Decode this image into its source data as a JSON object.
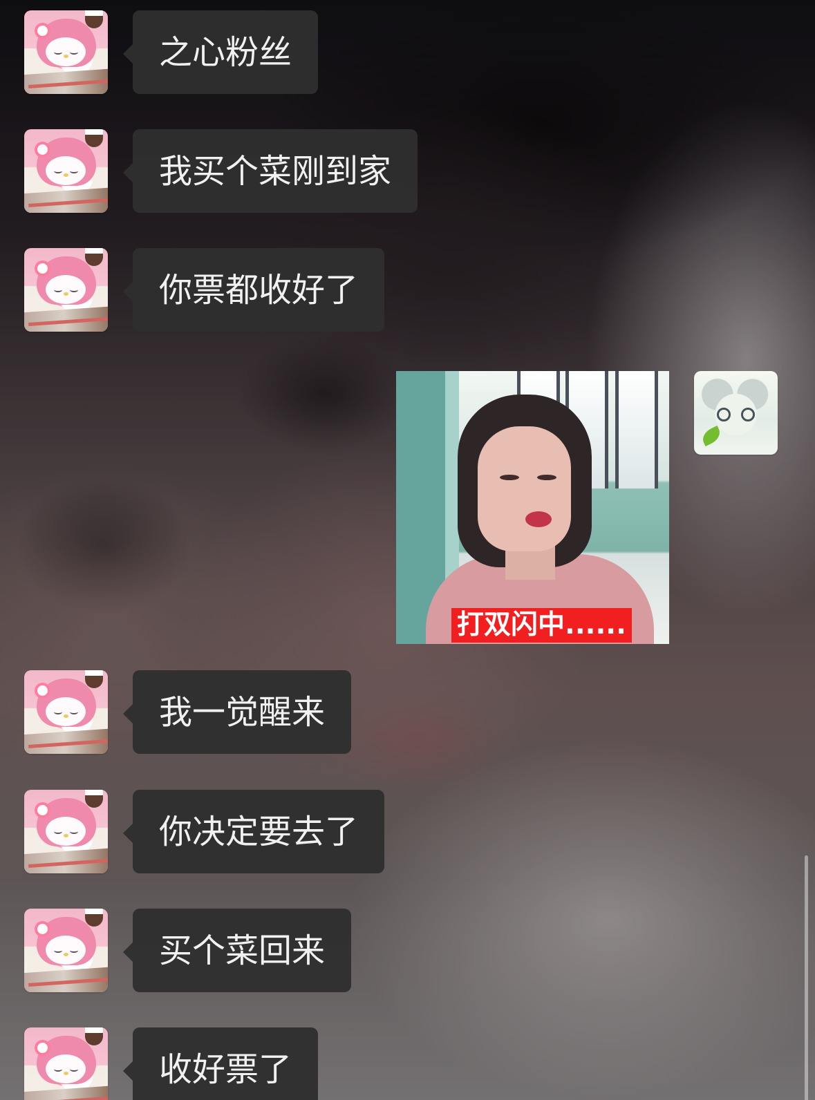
{
  "chat": {
    "messages": [
      {
        "side": "left",
        "text": "之心粉丝",
        "avatar_icon": "my-melody-avatar-icon"
      },
      {
        "side": "left",
        "text": "我买个菜刚到家",
        "avatar_icon": "my-melody-avatar-icon"
      },
      {
        "side": "left",
        "text": "你票都收好了",
        "avatar_icon": "my-melody-avatar-icon"
      },
      {
        "side": "right",
        "type": "sticker",
        "caption": "打双闪中......",
        "avatar_icon": "plush-cat-avatar-icon"
      },
      {
        "side": "left",
        "text": "我一觉醒来",
        "avatar_icon": "my-melody-avatar-icon"
      },
      {
        "side": "left",
        "text": "你决定要去了",
        "avatar_icon": "my-melody-avatar-icon"
      },
      {
        "side": "left",
        "text": "买个菜回来",
        "avatar_icon": "my-melody-avatar-icon"
      },
      {
        "side": "left",
        "text": "收好票了",
        "avatar_icon": "my-melody-avatar-icon"
      }
    ]
  },
  "colors": {
    "incoming_bubble": "#2f2f2f",
    "message_text": "#f1f1f1",
    "sticker_caption_background": "#f21f20"
  }
}
